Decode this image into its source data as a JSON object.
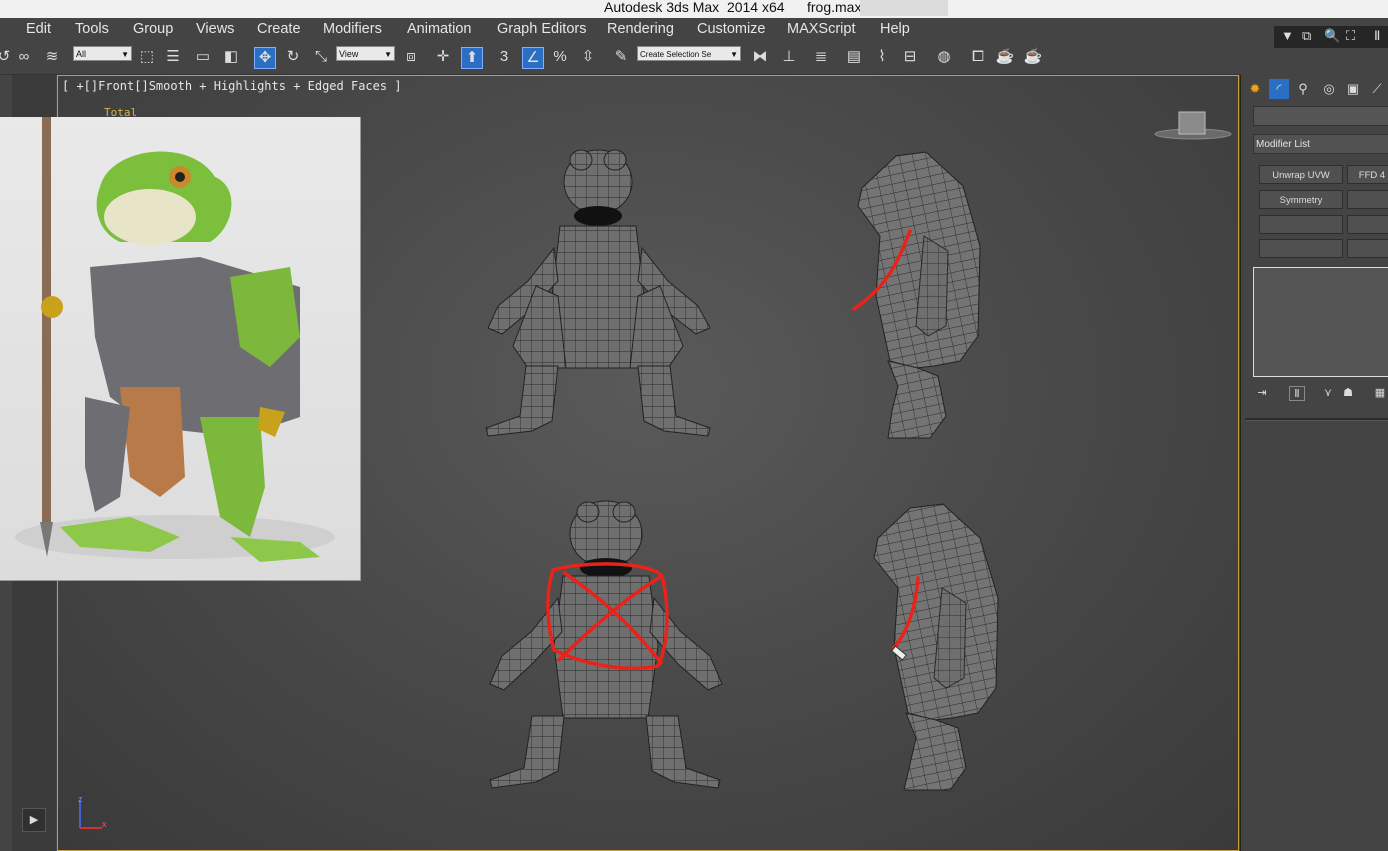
{
  "window": {
    "app_title": "Autodesk 3ds Max  2014 x64",
    "file_name": "frog.max"
  },
  "menu": [
    "Edit",
    "Tools",
    "Group",
    "Views",
    "Create",
    "Modifiers",
    "Animation",
    "Graph Editors",
    "Rendering",
    "Customize",
    "MAXScript",
    "Help"
  ],
  "toolbar": {
    "filter_value": "All",
    "ref_coord_value": "View",
    "selection_set_placeholder": "Create Selection Se",
    "snap_3_label": "3",
    "percent_label": "%"
  },
  "viewport": {
    "label": "[ +[]Front[]Smooth + Highlights + Edged Faces ]",
    "stats_label": "Total",
    "axis_z": "z",
    "axis_x": "x"
  },
  "command_panel": {
    "modifier_list": "Modifier List",
    "buttons": [
      "Unwrap UVW",
      "FFD 4",
      "Symmetry"
    ]
  },
  "colors": {
    "accent": "#2b6fc4",
    "viewport_border": "#c8a033",
    "annotation": "#e8231a"
  }
}
